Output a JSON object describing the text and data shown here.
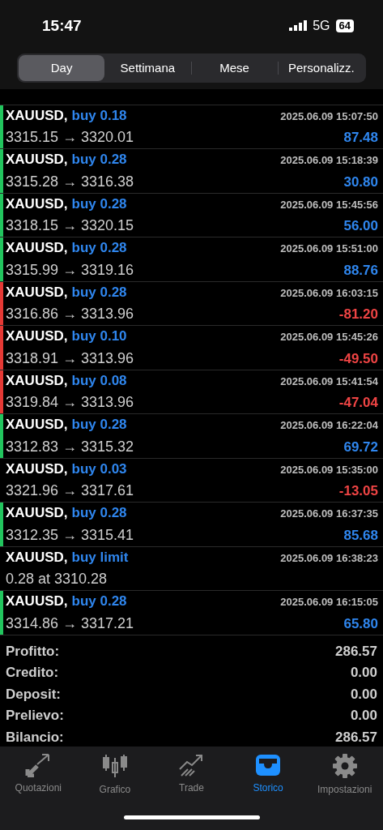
{
  "status_bar": {
    "time": "15:47",
    "network": "5G",
    "battery": "64"
  },
  "tabs": [
    {
      "label": "Day",
      "selected": true
    },
    {
      "label": "Settimana",
      "selected": false
    },
    {
      "label": "Mese",
      "selected": false
    },
    {
      "label": "Personalizz.",
      "selected": false
    }
  ],
  "deals": [
    {
      "symbol": "XAUUSD,",
      "order": "buy 0.18",
      "time": "2025.06.09 15:07:50",
      "prices": "3315.15 → 3320.01",
      "profit": "87.48",
      "kind": "gain",
      "color": "#22c55e"
    },
    {
      "symbol": "XAUUSD,",
      "order": "buy 0.28",
      "time": "2025.06.09 15:18:39",
      "prices": "3315.28 → 3316.38",
      "profit": "30.80",
      "kind": "gain",
      "color": "#22c55e"
    },
    {
      "symbol": "XAUUSD,",
      "order": "buy 0.28",
      "time": "2025.06.09 15:45:56",
      "prices": "3318.15 → 3320.15",
      "profit": "56.00",
      "kind": "gain",
      "color": "#22c55e"
    },
    {
      "symbol": "XAUUSD,",
      "order": "buy 0.28",
      "time": "2025.06.09 15:51:00",
      "prices": "3315.99 → 3319.16",
      "profit": "88.76",
      "kind": "gain",
      "color": "#22c55e"
    },
    {
      "symbol": "XAUUSD,",
      "order": "buy 0.28",
      "time": "2025.06.09 16:03:15",
      "prices": "3316.86 → 3313.96",
      "profit": "-81.20",
      "kind": "loss",
      "color": "#e53935"
    },
    {
      "symbol": "XAUUSD,",
      "order": "buy 0.10",
      "time": "2025.06.09 15:45:26",
      "prices": "3318.91 → 3313.96",
      "profit": "-49.50",
      "kind": "loss",
      "color": "#e53935"
    },
    {
      "symbol": "XAUUSD,",
      "order": "buy 0.08",
      "time": "2025.06.09 15:41:54",
      "prices": "3319.84 → 3313.96",
      "profit": "-47.04",
      "kind": "loss",
      "color": "#e53935"
    },
    {
      "symbol": "XAUUSD,",
      "order": "buy 0.28",
      "time": "2025.06.09 16:22:04",
      "prices": "3312.83 → 3315.32",
      "profit": "69.72",
      "kind": "gain",
      "color": "#22c55e"
    },
    {
      "symbol": "XAUUSD,",
      "order": "buy 0.03",
      "time": "2025.06.09 15:35:00",
      "prices": "3321.96 → 3317.61",
      "profit": "-13.05",
      "kind": "loss"
    },
    {
      "symbol": "XAUUSD,",
      "order": "buy 0.28",
      "time": "2025.06.09 16:37:35",
      "prices": "3312.35 → 3315.41",
      "profit": "85.68",
      "kind": "gain",
      "color": "#22c55e"
    },
    {
      "symbol": "XAUUSD,",
      "order": "buy limit",
      "time": "2025.06.09 16:38:23",
      "prices": "0.28 at 3310.28"
    },
    {
      "symbol": "XAUUSD,",
      "order": "buy 0.28",
      "time": "2025.06.09 16:15:05",
      "prices": "3314.86 → 3317.21",
      "profit": "65.80",
      "kind": "gain",
      "color": "#22c55e"
    }
  ],
  "summary": [
    {
      "label": "Profitto:",
      "value": "286.57"
    },
    {
      "label": "Credito:",
      "value": "0.00"
    },
    {
      "label": "Deposit:",
      "value": "0.00"
    },
    {
      "label": "Prelievo:",
      "value": "0.00"
    },
    {
      "label": "Bilancio:",
      "value": "286.57"
    }
  ],
  "bottom_nav": [
    {
      "label": "Quotazioni",
      "kind": "quotes",
      "selected": false
    },
    {
      "label": "Grafico",
      "kind": "chart",
      "selected": false
    },
    {
      "label": "Trade",
      "kind": "trade",
      "selected": false
    },
    {
      "label": "Storico",
      "kind": "history",
      "selected": true
    },
    {
      "label": "Impostazioni",
      "kind": "settings",
      "selected": false
    }
  ]
}
